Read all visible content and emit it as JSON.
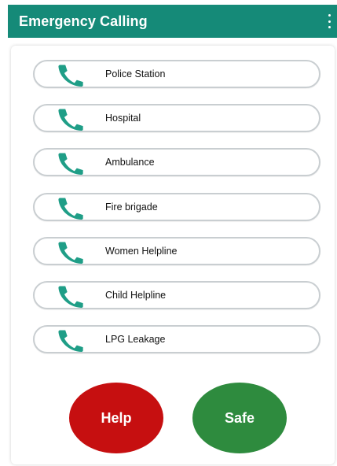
{
  "appbar": {
    "title": "Emergency Calling",
    "menu_icon": "overflow-menu-icon"
  },
  "contacts": [
    {
      "label": "Police Station",
      "icon": "phone-icon"
    },
    {
      "label": "Hospital",
      "icon": "phone-icon"
    },
    {
      "label": "Ambulance",
      "icon": "phone-icon"
    },
    {
      "label": "Fire brigade",
      "icon": "phone-icon"
    },
    {
      "label": "Women Helpline",
      "icon": "phone-icon"
    },
    {
      "label": "Child Helpline",
      "icon": "phone-icon"
    },
    {
      "label": "LPG Leakage",
      "icon": "phone-icon"
    }
  ],
  "actions": {
    "help_label": "Help",
    "safe_label": "Safe"
  },
  "colors": {
    "appbar": "#158a78",
    "phone_icon": "#1f9e87",
    "help": "#c60f10",
    "safe": "#2e8b3e"
  }
}
